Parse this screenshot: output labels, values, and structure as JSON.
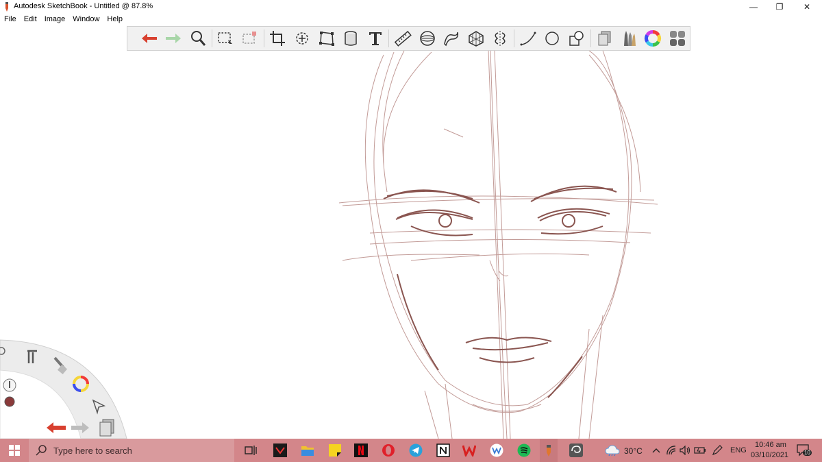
{
  "window": {
    "title": "Autodesk SketchBook - Untitled @ 87.8%",
    "controls": {
      "minimize": "—",
      "restore": "❐",
      "close": "✕"
    }
  },
  "menu": {
    "items": [
      "File",
      "Edit",
      "Image",
      "Window",
      "Help"
    ]
  },
  "toolbar": {
    "tools": [
      "undo-icon",
      "redo-icon",
      "zoom-icon",
      "select-icon",
      "lasso-select-icon",
      "crop-icon",
      "transform-icon",
      "distort-icon",
      "fill-icon",
      "text-icon",
      "ruler-icon",
      "ellipse-guide-icon",
      "french-curve-icon",
      "perspective-icon",
      "symmetry-icon",
      "line-icon",
      "circle-icon",
      "shape-icon",
      "layers-icon",
      "brushes-icon",
      "color-wheel-icon",
      "copic-library-icon"
    ]
  },
  "lagoon": {
    "icons": [
      "settings-icon",
      "tools-icon",
      "brush-icon",
      "color-wheel-icon",
      "brush-size-icon",
      "color-puck-icon",
      "select-icon",
      "undo-icon",
      "redo-icon",
      "layers-icon"
    ],
    "accent": "#c8382c"
  },
  "taskbar": {
    "search_placeholder": "Type here to search",
    "weather": "30°C",
    "language": "ENG",
    "time": "10:46 am",
    "date": "03/10/2021",
    "notification_count": "10",
    "background": "#d3868a"
  }
}
